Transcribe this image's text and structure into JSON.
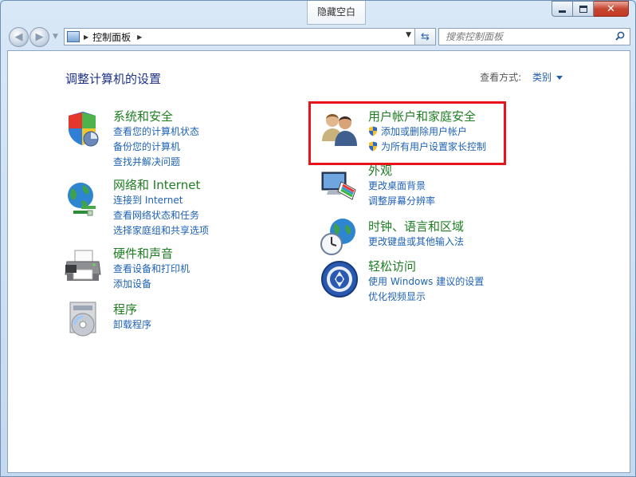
{
  "window": {
    "tooltip_tab": "隐藏空白",
    "min_label": "",
    "close_glyph": "✕"
  },
  "address_bar": {
    "breadcrumb": "控制面板"
  },
  "search": {
    "placeholder": "搜索控制面板"
  },
  "main": {
    "heading": "调整计算机的设置",
    "view_by_label": "查看方式:",
    "view_by_value": "类别"
  },
  "categories_left": [
    {
      "title": "系统和安全",
      "icon": "shield-icon",
      "links": [
        "查看您的计算机状态",
        "备份您的计算机",
        "查找并解决问题"
      ]
    },
    {
      "title": "网络和 Internet",
      "icon": "network-globe-icon",
      "links": [
        "连接到 Internet",
        "查看网络状态和任务",
        "选择家庭组和共享选项"
      ]
    },
    {
      "title": "硬件和声音",
      "icon": "printer-icon",
      "links": [
        "查看设备和打印机",
        "添加设备"
      ]
    },
    {
      "title": "程序",
      "icon": "programs-disc-icon",
      "links": [
        "卸载程序"
      ]
    }
  ],
  "categories_right": [
    {
      "title": "用户帐户和家庭安全",
      "icon": "users-icon",
      "links": [
        "添加或删除用户帐户",
        "为所有用户设置家长控制"
      ]
    },
    {
      "title": "外观",
      "icon": "monitor-paint-icon",
      "links": [
        "更改桌面背景",
        "调整屏幕分辨率"
      ]
    },
    {
      "title": "时钟、语言和区域",
      "icon": "clock-globe-icon",
      "links": [
        "更改键盘或其他输入法"
      ]
    },
    {
      "title": "轻松访问",
      "icon": "ease-of-access-icon",
      "links": [
        "使用 Windows 建议的设置",
        "优化视频显示"
      ]
    }
  ],
  "colors": {
    "category_title": "#1e7d20",
    "link": "#1e62b5",
    "heading": "#1e3287",
    "highlight_border": "#e8141a"
  }
}
